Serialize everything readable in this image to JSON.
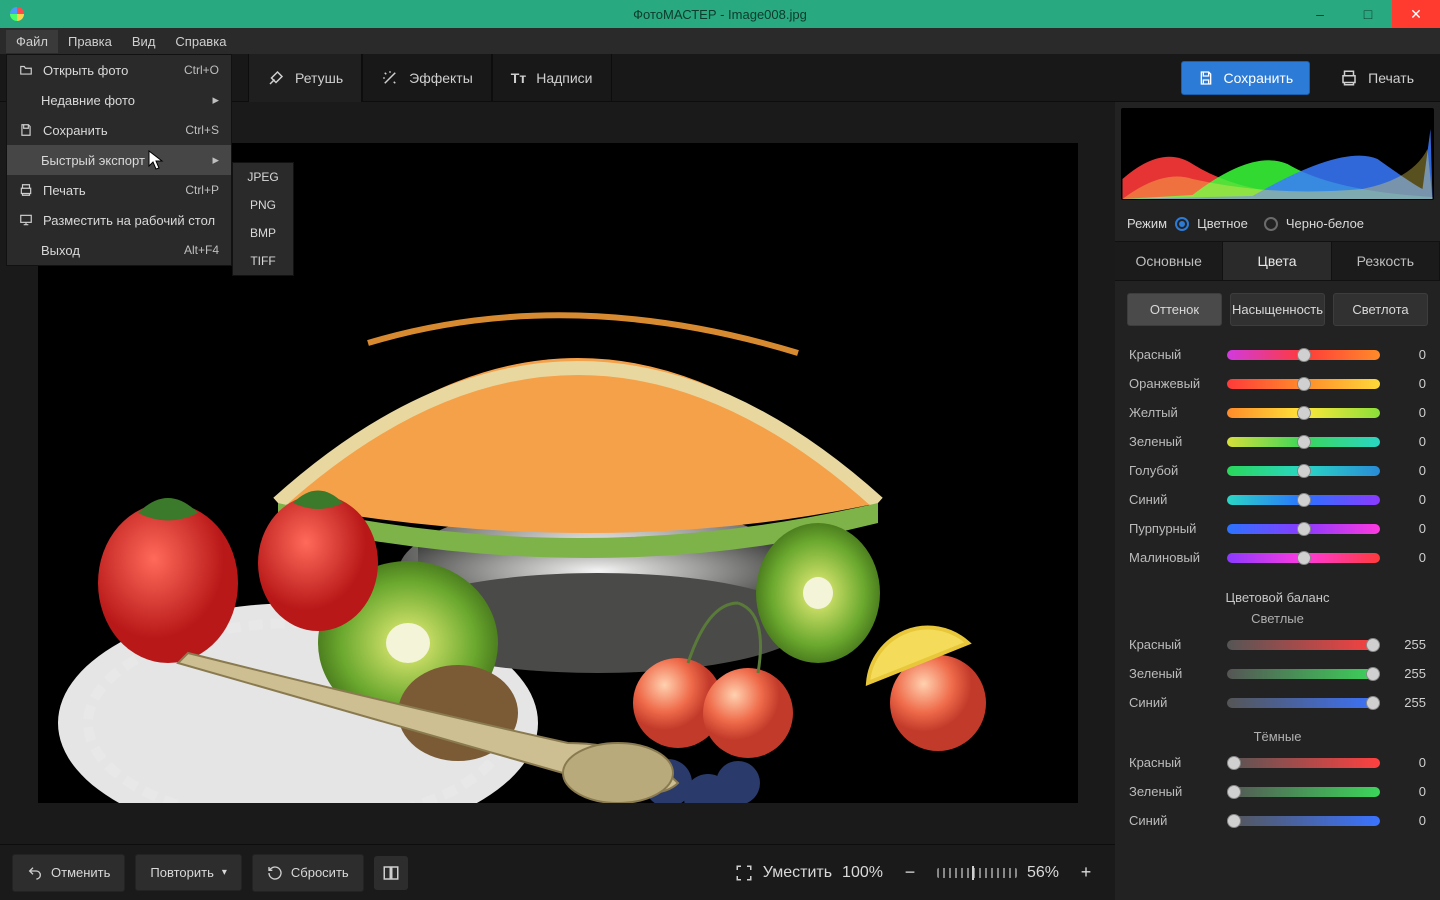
{
  "titlebar": {
    "title": "ФотоМАСТЕР - Image008.jpg"
  },
  "menubar": [
    "Файл",
    "Правка",
    "Вид",
    "Справка"
  ],
  "tabs": [
    {
      "label": "Ретушь"
    },
    {
      "label": "Эффекты"
    },
    {
      "label": "Надписи"
    }
  ],
  "save_btn": "Сохранить",
  "print_btn": "Печать",
  "file_menu": [
    {
      "label": "Открыть фото",
      "shortcut": "Ctrl+O",
      "icon": "folder"
    },
    {
      "label": "Недавние фото",
      "shortcut": "",
      "arrow": true,
      "indent": true
    },
    {
      "label": "Сохранить",
      "shortcut": "Ctrl+S",
      "icon": "save"
    },
    {
      "label": "Быстрый экспорт",
      "shortcut": "",
      "arrow": true,
      "highlight": true,
      "indent": true
    },
    {
      "label": "Печать",
      "shortcut": "Ctrl+P",
      "icon": "print"
    },
    {
      "label": "Разместить на рабочий стол",
      "shortcut": "",
      "icon": "desktop"
    },
    {
      "label": "Выход",
      "shortcut": "Alt+F4",
      "indent": true
    }
  ],
  "submenu": [
    "JPEG",
    "PNG",
    "BMP",
    "TIFF"
  ],
  "mode": {
    "label": "Режим",
    "opt1": "Цветное",
    "opt2": "Черно-белое"
  },
  "subtabs": [
    "Основные",
    "Цвета",
    "Резкость"
  ],
  "pills": [
    "Оттенок",
    "Насыщенность",
    "Светлота"
  ],
  "hue_sliders": [
    {
      "label": "Красный",
      "value": "0",
      "grad": "linear-gradient(to right,#d13adf,#ff3a3a,#ff8b2a)"
    },
    {
      "label": "Оранжевый",
      "value": "0",
      "grad": "linear-gradient(to right,#ff3a3a,#ff8b2a,#ffd83a)"
    },
    {
      "label": "Желтый",
      "value": "0",
      "grad": "linear-gradient(to right,#ff8b2a,#ffe53a,#8be03a)"
    },
    {
      "label": "Зеленый",
      "value": "0",
      "grad": "linear-gradient(to right,#d6e03a,#3ad65a,#2ad6c4)"
    },
    {
      "label": "Голубой",
      "value": "0",
      "grad": "linear-gradient(to right,#2ad65a,#2ad6c4,#2a8bd6)"
    },
    {
      "label": "Синий",
      "value": "0",
      "grad": "linear-gradient(to right,#2ad6c4,#2a73ff,#8b3aff)"
    },
    {
      "label": "Пурпурный",
      "value": "0",
      "grad": "linear-gradient(to right,#2a73ff,#8b3aff,#ff3adf)"
    },
    {
      "label": "Малиновый",
      "value": "0",
      "grad": "linear-gradient(to right,#8b3aff,#ff3adf,#ff3a3a)"
    }
  ],
  "balance_title": "Цветовой баланс",
  "light_title": "Светлые",
  "dark_title": "Тёмные",
  "light_sliders": [
    {
      "label": "Красный",
      "value": "255",
      "grad": "linear-gradient(to right,#555,#ff4040)"
    },
    {
      "label": "Зеленый",
      "value": "255",
      "grad": "linear-gradient(to right,#555,#3bd65a)"
    },
    {
      "label": "Синий",
      "value": "255",
      "grad": "linear-gradient(to right,#555,#3b73ff)"
    }
  ],
  "dark_sliders": [
    {
      "label": "Красный",
      "value": "0",
      "grad": "linear-gradient(to right,#555,#ff4040)"
    },
    {
      "label": "Зеленый",
      "value": "0",
      "grad": "linear-gradient(to right,#555,#3bd65a)"
    },
    {
      "label": "Синий",
      "value": "0",
      "grad": "linear-gradient(to right,#555,#3b73ff)"
    }
  ],
  "footer": {
    "undo": "Отменить",
    "redo": "Повторить",
    "reset": "Сбросить",
    "fit": "Уместить",
    "zoom_levels": [
      "100%",
      "56%"
    ]
  }
}
